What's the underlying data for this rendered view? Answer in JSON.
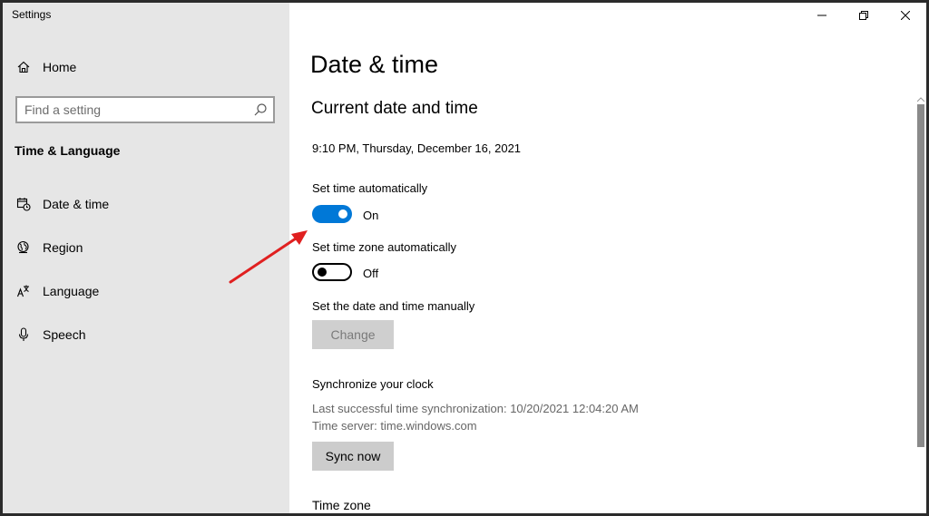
{
  "window": {
    "title": "Settings"
  },
  "sidebar": {
    "home_label": "Home",
    "search_placeholder": "Find a setting",
    "section_title": "Time & Language",
    "items": [
      {
        "label": "Date & time",
        "icon": "calendar-clock-icon"
      },
      {
        "label": "Region",
        "icon": "globe-icon"
      },
      {
        "label": "Language",
        "icon": "language-icon"
      },
      {
        "label": "Speech",
        "icon": "microphone-icon"
      }
    ]
  },
  "main": {
    "page_title": "Date & time",
    "section_title": "Current date and time",
    "current_datetime": "9:10 PM, Thursday, December 16, 2021",
    "set_time_auto": {
      "label": "Set time automatically",
      "state": "On"
    },
    "set_timezone_auto": {
      "label": "Set time zone automatically",
      "state": "Off"
    },
    "manual": {
      "label": "Set the date and time manually",
      "button": "Change"
    },
    "sync": {
      "title": "Synchronize your clock",
      "last_sync": "Last successful time synchronization: 10/20/2021 12:04:20 AM",
      "server": "Time server: time.windows.com",
      "button": "Sync now"
    },
    "timezone_title": "Time zone"
  },
  "colors": {
    "accent": "#0078d7",
    "sidebar_bg": "#e6e6e6",
    "annotation_arrow": "#e02020"
  }
}
